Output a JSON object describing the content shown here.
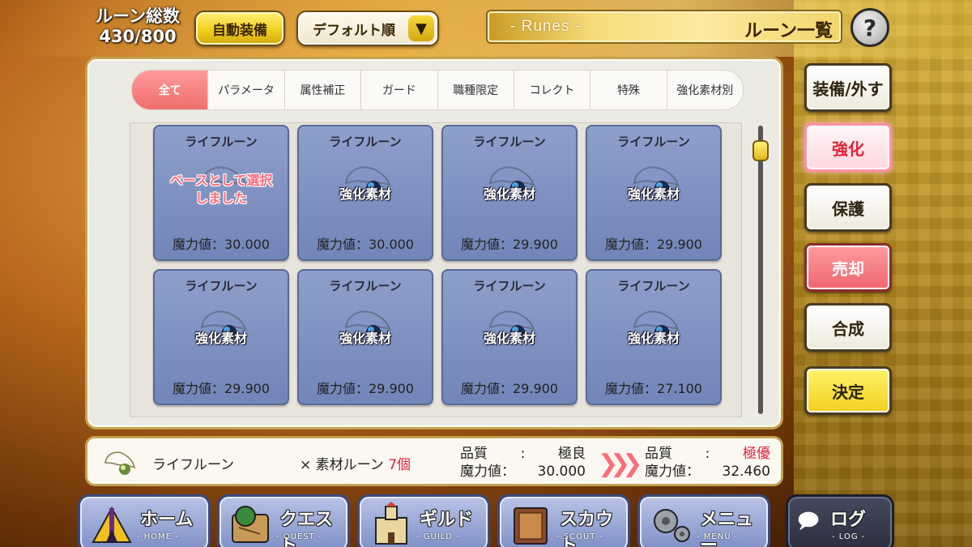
{
  "header": {
    "rune_total_label": "ルーン総数",
    "rune_total_value": "430/800",
    "auto_equip": "自動装備",
    "sort": "デフォルト順",
    "banner_en": "- Runes -",
    "banner_jp": "ルーン一覧",
    "help": "?"
  },
  "tabs": [
    "全て",
    "パラメータ",
    "属性補正",
    "ガード",
    "職種限定",
    "コレクト",
    "特殊",
    "強化素材別"
  ],
  "cards": [
    {
      "name": "ライフルーン",
      "status": "ベースとして選択しました",
      "power": "魔力値：30.000"
    },
    {
      "name": "ライフルーン",
      "status": "強化素材",
      "power": "魔力値：30.000"
    },
    {
      "name": "ライフルーン",
      "status": "強化素材",
      "power": "魔力値：29.900"
    },
    {
      "name": "ライフルーン",
      "status": "強化素材",
      "power": "魔力値：29.900"
    },
    {
      "name": "ライフルーン",
      "status": "強化素材",
      "power": "魔力値：29.900"
    },
    {
      "name": "ライフルーン",
      "status": "強化素材",
      "power": "魔力値：29.900"
    },
    {
      "name": "ライフルーン",
      "status": "強化素材",
      "power": "魔力値：29.900"
    },
    {
      "name": "ライフルーン",
      "status": "強化素材",
      "power": "魔力値：27.100"
    }
  ],
  "card_base_line1": "ベースとして選択",
  "card_base_line2": "しました",
  "side_buttons": [
    "装備/外す",
    "強化",
    "保護",
    "売却",
    "合成",
    "決定"
  ],
  "summary": {
    "rune_name": "ライフルーン",
    "material_prefix": "× 素材ルーン",
    "material_count": "7個",
    "before_quality_label": "品質",
    "before_quality_value": "極良",
    "before_power_label": "魔力値：",
    "before_power_value": "30.000",
    "after_quality_label": "品質",
    "after_quality_value": "極優",
    "after_power_label": "魔力値：",
    "after_power_value": "32.460",
    "colon": ":"
  },
  "nav": [
    {
      "jp": "ホーム",
      "en": "- HOME -"
    },
    {
      "jp": "クエスト",
      "en": "- QUEST -"
    },
    {
      "jp": "ギルド",
      "en": "- GUILD -"
    },
    {
      "jp": "スカウト",
      "en": "- SCOUT -"
    },
    {
      "jp": "メニュー",
      "en": "- MENU -"
    },
    {
      "jp": "ログ",
      "en": "- LOG -"
    }
  ],
  "icons": {
    "rune": "rune-icon",
    "help": "help-icon"
  },
  "colors": {
    "active_tab": "#f06e6e",
    "card": "#7f91c2",
    "highlight": "#e0223a"
  }
}
